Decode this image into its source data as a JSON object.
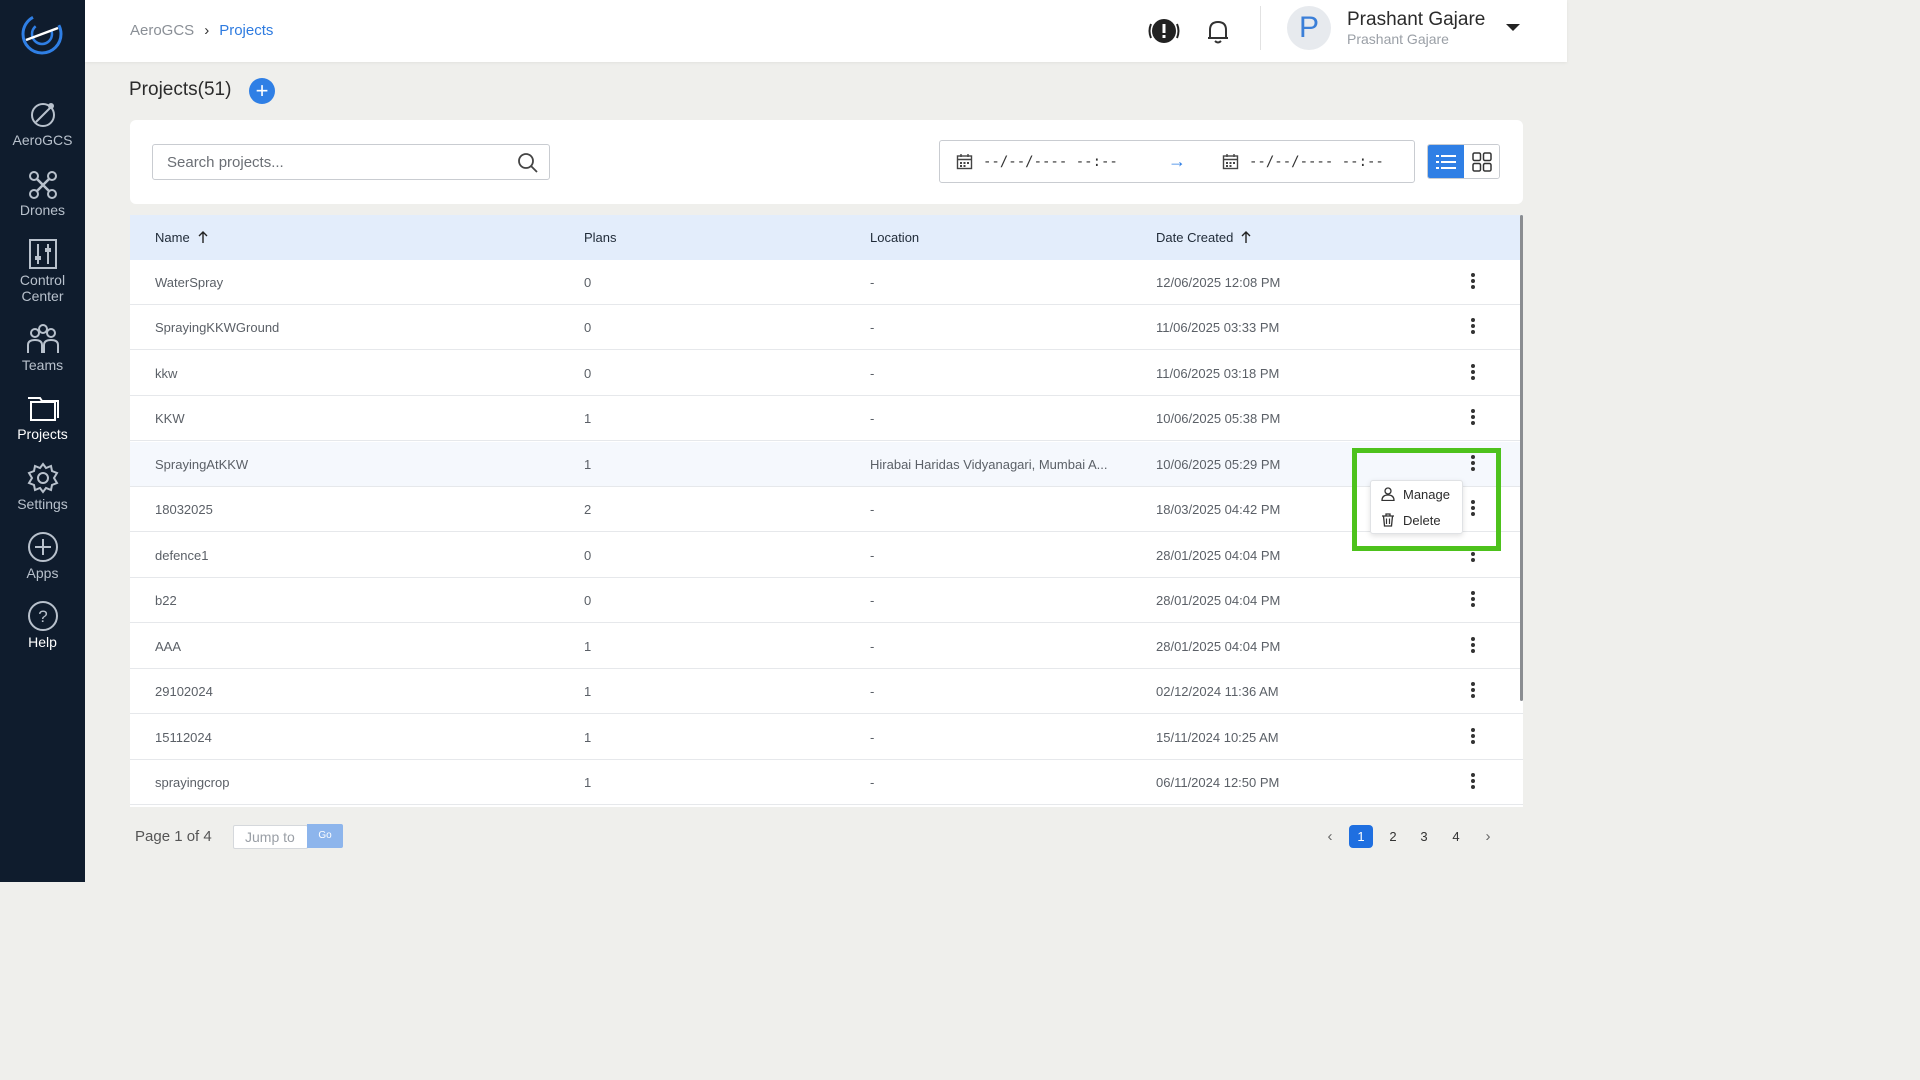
{
  "sidebar": {
    "items": [
      {
        "label": "AeroGCS"
      },
      {
        "label": "Drones"
      },
      {
        "label": "Control Center"
      },
      {
        "label": "Teams"
      },
      {
        "label": "Projects"
      },
      {
        "label": "Settings"
      },
      {
        "label": "Apps"
      },
      {
        "label": "Help"
      }
    ]
  },
  "header": {
    "breadcrumb": {
      "root": "AeroGCS",
      "separator": "›",
      "current": "Projects"
    },
    "user": {
      "avatar_letter": "P",
      "name": "Prashant Gajare",
      "subtitle": "Prashant Gajare"
    }
  },
  "page": {
    "title": "Projects(51)",
    "add_label": "+"
  },
  "filters": {
    "search_placeholder": "Search projects...",
    "date_from": "--/--/---- --:--",
    "date_to": "--/--/---- --:--",
    "arrow": "→"
  },
  "table": {
    "headers": {
      "name": "Name",
      "plans": "Plans",
      "location": "Location",
      "date_created": "Date Created"
    },
    "rows": [
      {
        "name": "WaterSpray",
        "plans": "0",
        "location": "-",
        "date": "12/06/2025 12:08 PM"
      },
      {
        "name": "SprayingKKWGround",
        "plans": "0",
        "location": "-",
        "date": "11/06/2025 03:33 PM"
      },
      {
        "name": "kkw",
        "plans": "0",
        "location": "-",
        "date": "11/06/2025 03:18 PM"
      },
      {
        "name": "KKW",
        "plans": "1",
        "location": "-",
        "date": "10/06/2025 05:38 PM"
      },
      {
        "name": "SprayingAtKKW",
        "plans": "1",
        "location": "Hirabai Haridas Vidyanagari, Mumbai A...",
        "date": "10/06/2025 05:29 PM"
      },
      {
        "name": "18032025",
        "plans": "2",
        "location": "-",
        "date": "18/03/2025 04:42 PM"
      },
      {
        "name": "defence1",
        "plans": "0",
        "location": "-",
        "date": "28/01/2025 04:04 PM"
      },
      {
        "name": "b22",
        "plans": "0",
        "location": "-",
        "date": "28/01/2025 04:04 PM"
      },
      {
        "name": "AAA",
        "plans": "1",
        "location": "-",
        "date": "28/01/2025 04:04 PM"
      },
      {
        "name": "29102024",
        "plans": "1",
        "location": "-",
        "date": "02/12/2024 11:36 AM"
      },
      {
        "name": "15112024",
        "plans": "1",
        "location": "-",
        "date": "15/11/2024 10:25 AM"
      },
      {
        "name": "sprayingcrop",
        "plans": "1",
        "location": "-",
        "date": "06/11/2024 12:50 PM"
      }
    ]
  },
  "context_menu": {
    "manage": "Manage",
    "delete": "Delete"
  },
  "pagination": {
    "info": "Page 1 of 4",
    "jump_placeholder": "Jump to",
    "go": "Go",
    "prev": "‹",
    "next": "›",
    "pages": [
      "1",
      "2",
      "3",
      "4"
    ],
    "current": "1"
  },
  "colors": {
    "accent": "#2f7fe5",
    "sidebar_bg": "#0f1c2d",
    "highlight": "#4dc21c",
    "header_row": "#e3edfb"
  }
}
